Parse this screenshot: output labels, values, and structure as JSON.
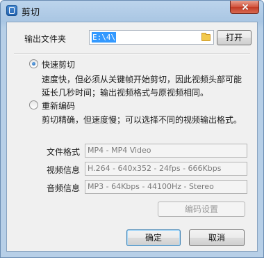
{
  "window": {
    "title": "剪切"
  },
  "output": {
    "label": "输出文件夹",
    "path_value": "E:\\4\\",
    "open_button": "打开"
  },
  "modes": {
    "fast_cut": {
      "label": "快速剪切",
      "selected": true,
      "description_line1": "速度快，但必须从关键帧开始剪切，因此视频头部可能",
      "description_line2": "延长几秒时间；输出视频格式与原视频相同。"
    },
    "reencode": {
      "label": "重新编码",
      "selected": false,
      "description": "剪切精确，但速度慢；可以选择不同的视频输出格式。"
    }
  },
  "info": {
    "format_label": "文件格式",
    "format_value": "MP4 - MP4 Video",
    "video_label": "视频信息",
    "video_value": "H.264 - 640x352 - 24fps - 666Kbps",
    "audio_label": "音频信息",
    "audio_value": "MP3 - 64Kbps - 44100Hz - Stereo",
    "encode_settings_button": "编码设置"
  },
  "footer": {
    "ok_button": "确定",
    "cancel_button": "取消"
  }
}
